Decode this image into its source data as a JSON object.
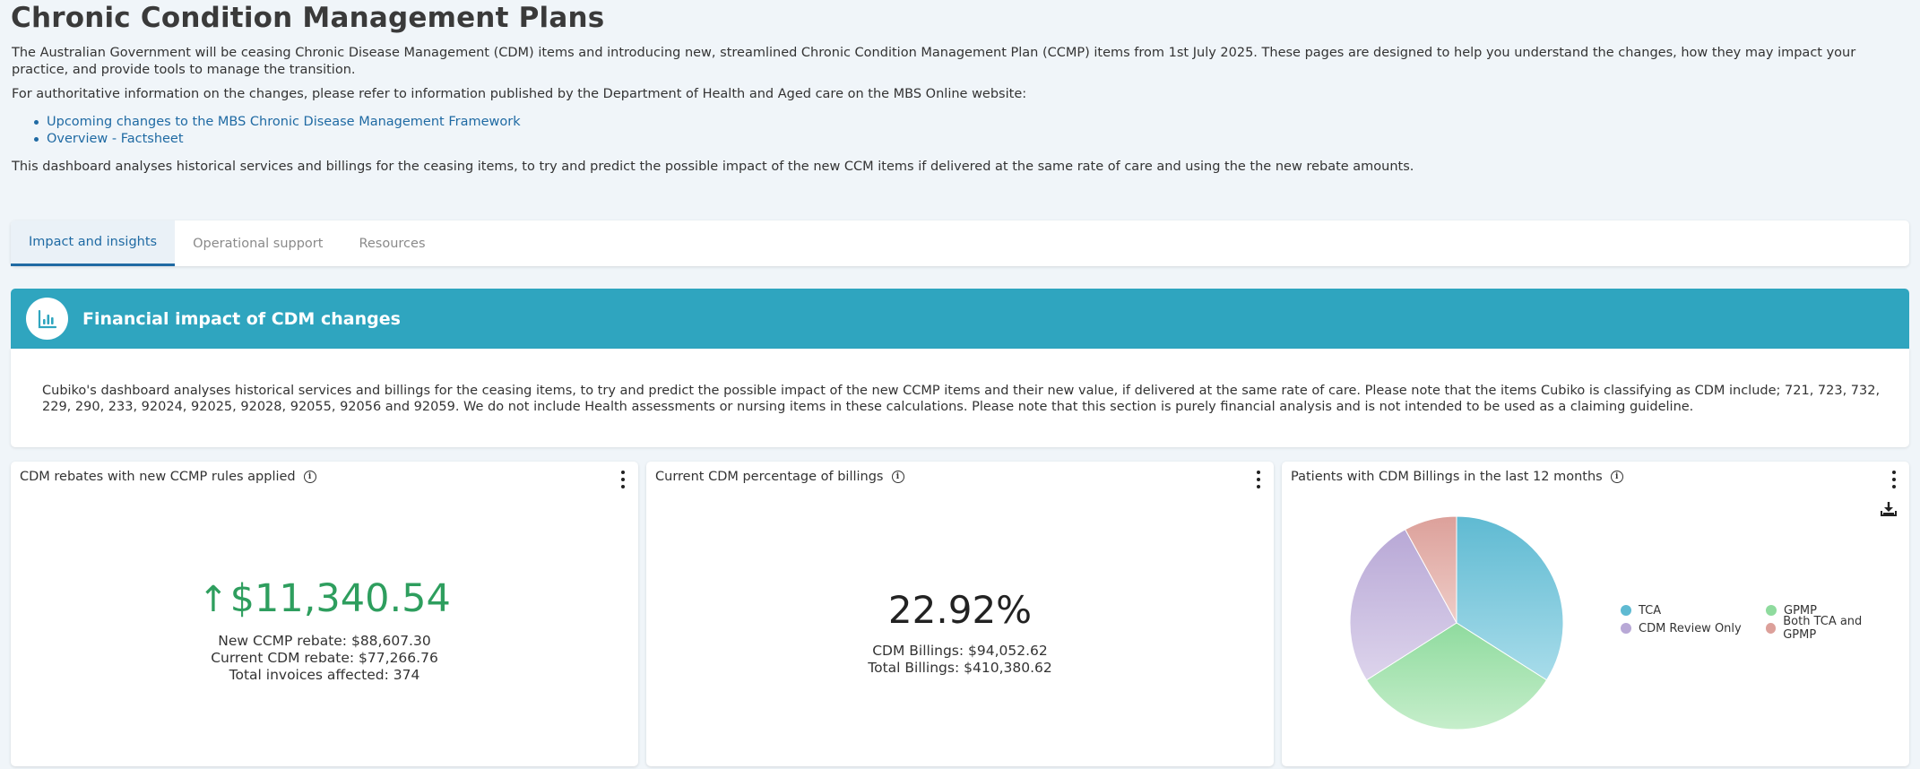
{
  "page": {
    "title": "Chronic Condition Management Plans",
    "intro1": "The Australian Government will be ceasing Chronic Disease Management (CDM) items and introducing new, streamlined Chronic Condition Management Plan (CCMP) items from 1st July 2025. These pages are designed to help you understand the changes, how they may impact your practice, and provide tools to manage the transition.",
    "intro2": "For authoritative information on the changes, please refer to information published by the Department of Health and Aged care on the MBS Online website:",
    "links": [
      "Upcoming changes to the MBS Chronic Disease Management Framework",
      "Overview - Factsheet"
    ],
    "intro3": "This dashboard analyses historical services and billings for the ceasing items, to try and predict the possible impact of the new CCM items if delivered at the same rate of care and using the the new rebate amounts."
  },
  "tabs": [
    "Impact and insights",
    "Operational support",
    "Resources"
  ],
  "banner": {
    "title": "Financial impact of CDM changes",
    "description": "Cubiko's dashboard analyses historical services and billings for the ceasing items, to try and predict the possible impact of the new CCMP items and their new value, if delivered at the same rate of care. Please note that the items Cubiko is classifying as CDM include; 721, 723, 732, 229, 290, 233, 92024, 92025, 92028, 92055, 92056 and 92059. We do not include Health assessments or nursing items in these calculations. Please note that this section is purely financial analysis and is not intended to be used as a claiming guideline."
  },
  "cards": {
    "rebates": {
      "title": "CDM rebates with new CCMP rules applied",
      "arrow": "↑",
      "value": "$11,340.54",
      "line1": "New CCMP rebate: $88,607.30",
      "line2": "Current CDM rebate: $77,266.76",
      "line3": "Total invoices affected: 374"
    },
    "percentage": {
      "title": "Current CDM percentage of billings",
      "value": "22.92%",
      "line1": "CDM Billings: $94,052.62",
      "line2": "Total Billings: $410,380.62"
    },
    "patients": {
      "title": "Patients with CDM Billings in the last 12 months",
      "download_icon": "download-icon",
      "legend": [
        "TCA",
        "GPMP",
        "CDM Review Only",
        "Both TCA and GPMP"
      ]
    }
  },
  "chart_data": {
    "type": "pie",
    "title": "Patients with CDM Billings in the last 12 months",
    "categories": [
      "TCA",
      "GPMP",
      "CDM Review Only",
      "Both TCA and GPMP"
    ],
    "values": [
      34,
      32,
      26,
      8
    ],
    "colors": [
      "#5fbad2",
      "#8fdb9e",
      "#b8a8d6",
      "#dca09a"
    ],
    "legend_position": "right"
  },
  "colors": {
    "accent": "#2fa5bf",
    "link": "#1f6aa3",
    "positive": "#2e9e5e"
  }
}
